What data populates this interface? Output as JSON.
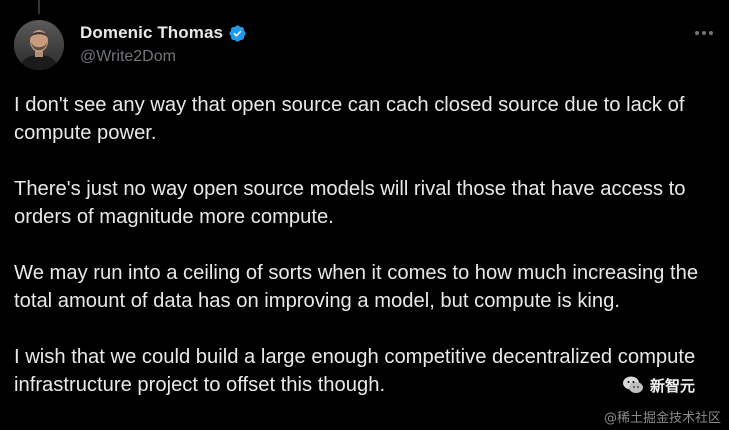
{
  "author": {
    "name": "Domenic Thomas",
    "handle": "@Write2Dom",
    "verified": true,
    "verified_color": "#1d9bf0"
  },
  "menu": {
    "icon": "more-horizontal-icon"
  },
  "tweet": {
    "paragraphs": [
      "I don't see any way that open source can cach closed source due to lack of compute power.",
      "There's just no way open source models will rival those that have access to orders of magnitude more compute.",
      "We may run into a ceiling of sorts when it comes to how much increasing the total amount of data has on improving a model, but compute is king.",
      "I wish that we could build a large enough competitive decentralized compute infrastructure project to offset this though."
    ]
  },
  "watermark": {
    "brand": "新智元",
    "source": "@稀土掘金技术社区"
  },
  "colors": {
    "background": "#000000",
    "text": "#e7e9ea",
    "secondary": "#71767b"
  }
}
